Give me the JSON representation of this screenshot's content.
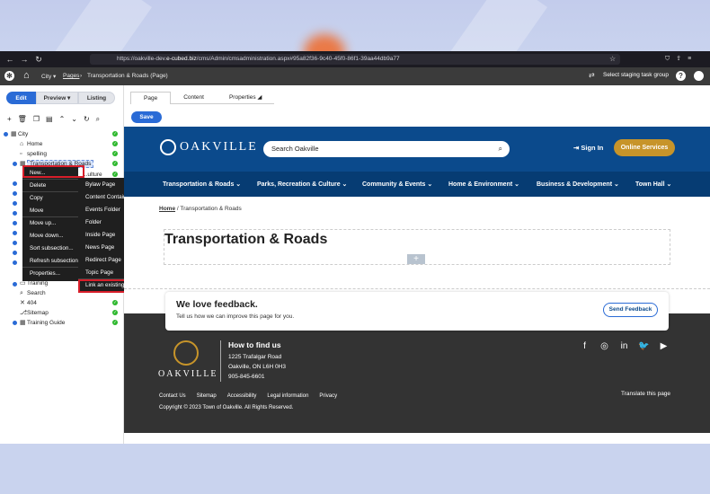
{
  "browser": {
    "url_prefix": "https://oakville-dev.",
    "url_domain": "e-cubed.biz",
    "url_path": "/cms/Admin/cmsadministration.aspx#95a82f36-9c40-45f0-86f1-39aa44db9a77"
  },
  "admin": {
    "site_crumb": "City",
    "pages_crumb": "Pages",
    "current_crumb": "Transportation & Roads (Page)",
    "staging": "Select staging task group"
  },
  "mode_tabs": {
    "edit": "Edit",
    "preview": "Preview",
    "listing": "Listing"
  },
  "tree": {
    "root": "City",
    "items": [
      "Home",
      "spelling",
      "Transportation & Roads",
      "...ulture",
      "Training",
      "Search",
      "404",
      "Sitemap",
      "Training Guide"
    ]
  },
  "context_menu": {
    "items": [
      "New...",
      "Delete",
      "Copy",
      "Move",
      "Move up...",
      "Move down...",
      "Sort subsection...",
      "Refresh subsection",
      "Properties..."
    ]
  },
  "submenu": {
    "items": [
      "Bylaw Page",
      "Content Container",
      "Events Folder",
      "Folder",
      "Inside Page",
      "News Page",
      "Redirect Page",
      "Topic Page",
      "Link an existing page"
    ]
  },
  "page_tabs": {
    "page": "Page",
    "content": "Content",
    "properties": "Properties"
  },
  "save_label": "Save",
  "site": {
    "logo": "OAKVILLE",
    "search_placeholder": "Search Oakville",
    "sign_in": "Sign In",
    "online_services": "Online Services",
    "nav": [
      "Transportation & Roads",
      "Parks, Recreation & Culture",
      "Community & Events",
      "Home & Environment",
      "Business & Development",
      "Town Hall"
    ],
    "breadcrumb_home": "Home",
    "breadcrumb_current": "Transportation & Roads",
    "page_title": "Transportation & Roads",
    "feedback_title": "We love feedback.",
    "feedback_text": "Tell us how we can improve this page for you.",
    "feedback_button": "Send Feedback",
    "footer_logo": "OAKVILLE",
    "how_to_find": "How to find us",
    "address_lines": [
      "1225 Trafalgar Road",
      "Oakville, ON L6H 0H3",
      "905-845-6601"
    ],
    "footer_links": [
      "Contact Us",
      "Sitemap",
      "Accessibility",
      "Legal information",
      "Privacy"
    ],
    "translate": "Translate this page",
    "copyright": "Copyright © 2023 Town of Oakville. All Rights Reserved."
  },
  "colors": {
    "brand_blue": "#0b4a8c",
    "nav_blue": "#063c73",
    "accent_gold": "#c7942a",
    "cms_blue": "#2a6bd6",
    "highlight_red": "#d81e2a"
  }
}
